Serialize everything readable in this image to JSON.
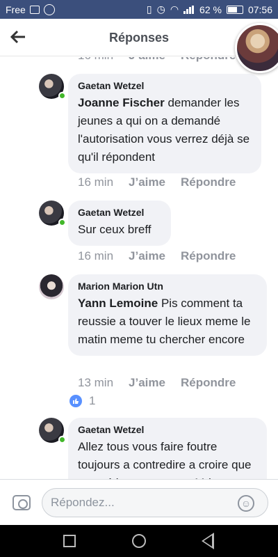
{
  "status": {
    "carrier": "Free",
    "battery": "62 %",
    "time": "07:56"
  },
  "header": {
    "title": "Réponses"
  },
  "top_meta": {
    "time": "16 min",
    "like": "J’aime",
    "reply": "Répondre"
  },
  "comments": [
    {
      "author": "Gaetan Wetzel",
      "tag": "Joanne Fischer",
      "text": " demander les jeunes a qui on a demandé l'autorisation vous verrez déjà se qu'il répondent",
      "time": "16 min",
      "like": "J’aime",
      "reply": "Répondre"
    },
    {
      "author": "Gaetan Wetzel",
      "tag": "",
      "text": "Sur ceux breff",
      "time": "16 min",
      "like": "J’aime",
      "reply": "Répondre"
    },
    {
      "author": "Marion Marion Utn",
      "tag": "Yann Lemoine",
      "text": " Pis comment ta reussie a touver le lieux meme le matin meme tu chercher encore",
      "time": "13 min",
      "like": "J’aime",
      "reply": "Répondre",
      "reactions": "1"
    },
    {
      "author": "Gaetan Wetzel",
      "tag": "",
      "text": "Allez tous vous faire foutre toujours a contredire a croire que vous étiez avec nous. Mdr",
      "time": "",
      "like": "",
      "reply": ""
    }
  ],
  "composer": {
    "placeholder": "Répondez..."
  },
  "icons": [
    "photo-icon",
    "messenger-icon",
    "vibrate-icon",
    "alarm-icon",
    "wifi-icon",
    "signal-icon",
    "battery-icon",
    "back-arrow-icon",
    "camera-icon",
    "emoji-icon",
    "like-reaction-icon",
    "nav-recent-icon",
    "nav-home-icon",
    "nav-back-icon"
  ],
  "colors": {
    "statusbar": "#3b4f7c",
    "bubble": "#f1f2f6",
    "online": "#42b72a",
    "like": "#5890ff"
  }
}
